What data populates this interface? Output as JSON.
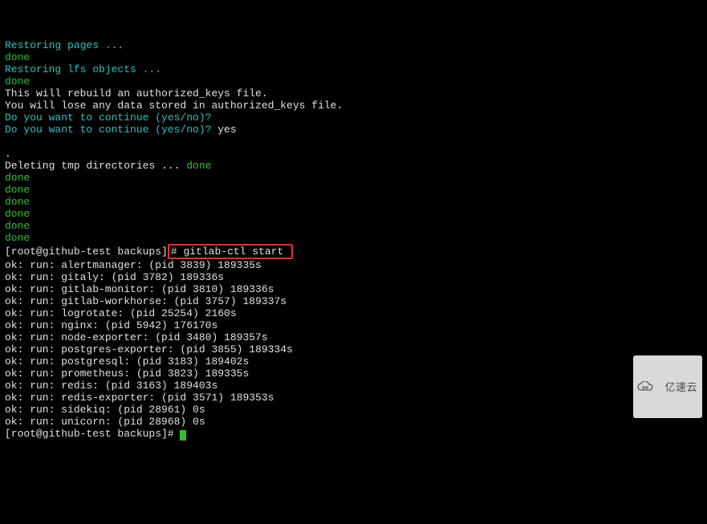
{
  "restoring_pages": "Restoring pages ...",
  "done": "done",
  "restoring_lfs": "Restoring lfs objects ...",
  "rebuild_notice1": "This will rebuild an authorized_keys file.",
  "rebuild_notice2": "You will lose any data stored in authorized_keys file.",
  "continue_q": "Do you want to continue (yes/no)?",
  "continue_answer": " yes",
  "dot": ".",
  "deleting_tmp": "Deleting tmp directories ... ",
  "prompt_host": "[root@github-test backups]",
  "prompt_hash": "#",
  "highlighted_cmd": " gitlab-ctl start ",
  "services": [
    "ok: run: alertmanager: (pid 3839) 189335s",
    "ok: run: gitaly: (pid 3782) 189336s",
    "ok: run: gitlab-monitor: (pid 3810) 189336s",
    "ok: run: gitlab-workhorse: (pid 3757) 189337s",
    "ok: run: logrotate: (pid 25254) 2160s",
    "ok: run: nginx: (pid 5942) 176170s",
    "ok: run: node-exporter: (pid 3480) 189357s",
    "ok: run: postgres-exporter: (pid 3855) 189334s",
    "ok: run: postgresql: (pid 3183) 189402s",
    "ok: run: prometheus: (pid 3823) 189335s",
    "ok: run: redis: (pid 3163) 189403s",
    "ok: run: redis-exporter: (pid 3571) 189353s",
    "ok: run: sidekiq: (pid 28961) 0s",
    "ok: run: unicorn: (pid 28968) 0s"
  ],
  "watermark": "亿速云"
}
